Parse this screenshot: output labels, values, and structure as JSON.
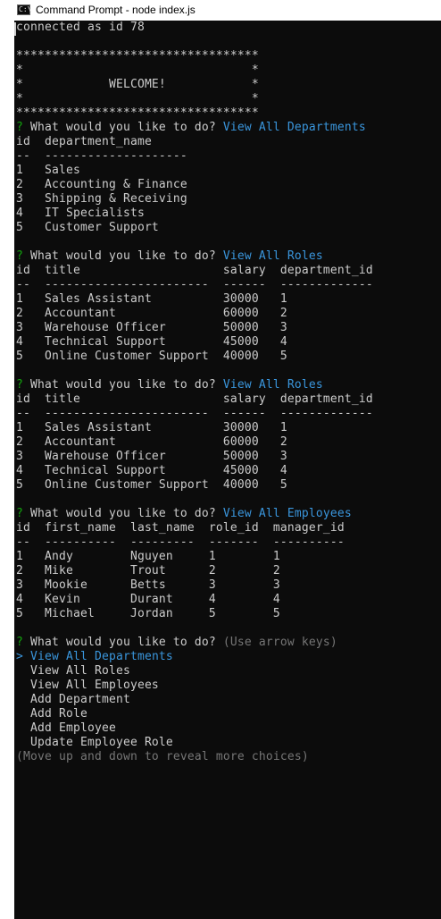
{
  "window": {
    "title": "Command Prompt - node  index.js",
    "icon_label": "C:\\"
  },
  "console": {
    "lines": [
      {
        "type": "plain",
        "text": "connected as id 78"
      },
      {
        "type": "plain",
        "text": ""
      },
      {
        "type": "plain",
        "text": "**********************************"
      },
      {
        "type": "plain",
        "text": "*                                *"
      },
      {
        "type": "plain",
        "text": "*            WELCOME!            *"
      },
      {
        "type": "plain",
        "text": "*                                *"
      },
      {
        "type": "plain",
        "text": "**********************************"
      },
      {
        "type": "prompt",
        "qmark": "?",
        "question": " What would you like to do? ",
        "answer": "View All Departments"
      },
      {
        "type": "plain",
        "text": "id  department_name"
      },
      {
        "type": "plain",
        "text": "--  --------------------"
      },
      {
        "type": "plain",
        "text": "1   Sales"
      },
      {
        "type": "plain",
        "text": "2   Accounting & Finance"
      },
      {
        "type": "plain",
        "text": "3   Shipping & Receiving"
      },
      {
        "type": "plain",
        "text": "4   IT Specialists"
      },
      {
        "type": "plain",
        "text": "5   Customer Support"
      },
      {
        "type": "plain",
        "text": ""
      },
      {
        "type": "prompt",
        "qmark": "?",
        "question": " What would you like to do? ",
        "answer": "View All Roles"
      },
      {
        "type": "plain",
        "text": "id  title                    salary  department_id"
      },
      {
        "type": "plain",
        "text": "--  -----------------------  ------  -------------"
      },
      {
        "type": "plain",
        "text": "1   Sales Assistant          30000   1"
      },
      {
        "type": "plain",
        "text": "2   Accountant               60000   2"
      },
      {
        "type": "plain",
        "text": "3   Warehouse Officer        50000   3"
      },
      {
        "type": "plain",
        "text": "4   Technical Support        45000   4"
      },
      {
        "type": "plain",
        "text": "5   Online Customer Support  40000   5"
      },
      {
        "type": "plain",
        "text": ""
      },
      {
        "type": "prompt",
        "qmark": "?",
        "question": " What would you like to do? ",
        "answer": "View All Roles"
      },
      {
        "type": "plain",
        "text": "id  title                    salary  department_id"
      },
      {
        "type": "plain",
        "text": "--  -----------------------  ------  -------------"
      },
      {
        "type": "plain",
        "text": "1   Sales Assistant          30000   1"
      },
      {
        "type": "plain",
        "text": "2   Accountant               60000   2"
      },
      {
        "type": "plain",
        "text": "3   Warehouse Officer        50000   3"
      },
      {
        "type": "plain",
        "text": "4   Technical Support        45000   4"
      },
      {
        "type": "plain",
        "text": "5   Online Customer Support  40000   5"
      },
      {
        "type": "plain",
        "text": ""
      },
      {
        "type": "prompt",
        "qmark": "?",
        "question": " What would you like to do? ",
        "answer": "View All Employees"
      },
      {
        "type": "plain",
        "text": "id  first_name  last_name  role_id  manager_id"
      },
      {
        "type": "plain",
        "text": "--  ----------  ---------  -------  ----------"
      },
      {
        "type": "plain",
        "text": "1   Andy        Nguyen     1        1"
      },
      {
        "type": "plain",
        "text": "2   Mike        Trout      2        2"
      },
      {
        "type": "plain",
        "text": "3   Mookie      Betts      3        3"
      },
      {
        "type": "plain",
        "text": "4   Kevin       Durant     4        4"
      },
      {
        "type": "plain",
        "text": "5   Michael     Jordan     5        5"
      },
      {
        "type": "plain",
        "text": ""
      },
      {
        "type": "prompt",
        "qmark": "?",
        "question": " What would you like to do? ",
        "answer": "(Use arrow keys)",
        "answer_style": "dim"
      },
      {
        "type": "choice",
        "selected": true,
        "pointer": ">",
        "text": " View All Departments"
      },
      {
        "type": "choice",
        "selected": false,
        "text": "  View All Roles"
      },
      {
        "type": "choice",
        "selected": false,
        "text": "  View All Employees"
      },
      {
        "type": "choice",
        "selected": false,
        "text": "  Add Department"
      },
      {
        "type": "choice",
        "selected": false,
        "text": "  Add Role"
      },
      {
        "type": "choice",
        "selected": false,
        "text": "  Add Employee"
      },
      {
        "type": "choice",
        "selected": false,
        "text": "  Update Employee Role"
      },
      {
        "type": "hint",
        "text": "(Move up and down to reveal more choices)"
      }
    ]
  },
  "colors": {
    "console_bg": "#0c0c0c",
    "text": "#cccccc",
    "prompt_qmark": "#13a10e",
    "answer": "#3a96dd",
    "hint": "#767676"
  }
}
